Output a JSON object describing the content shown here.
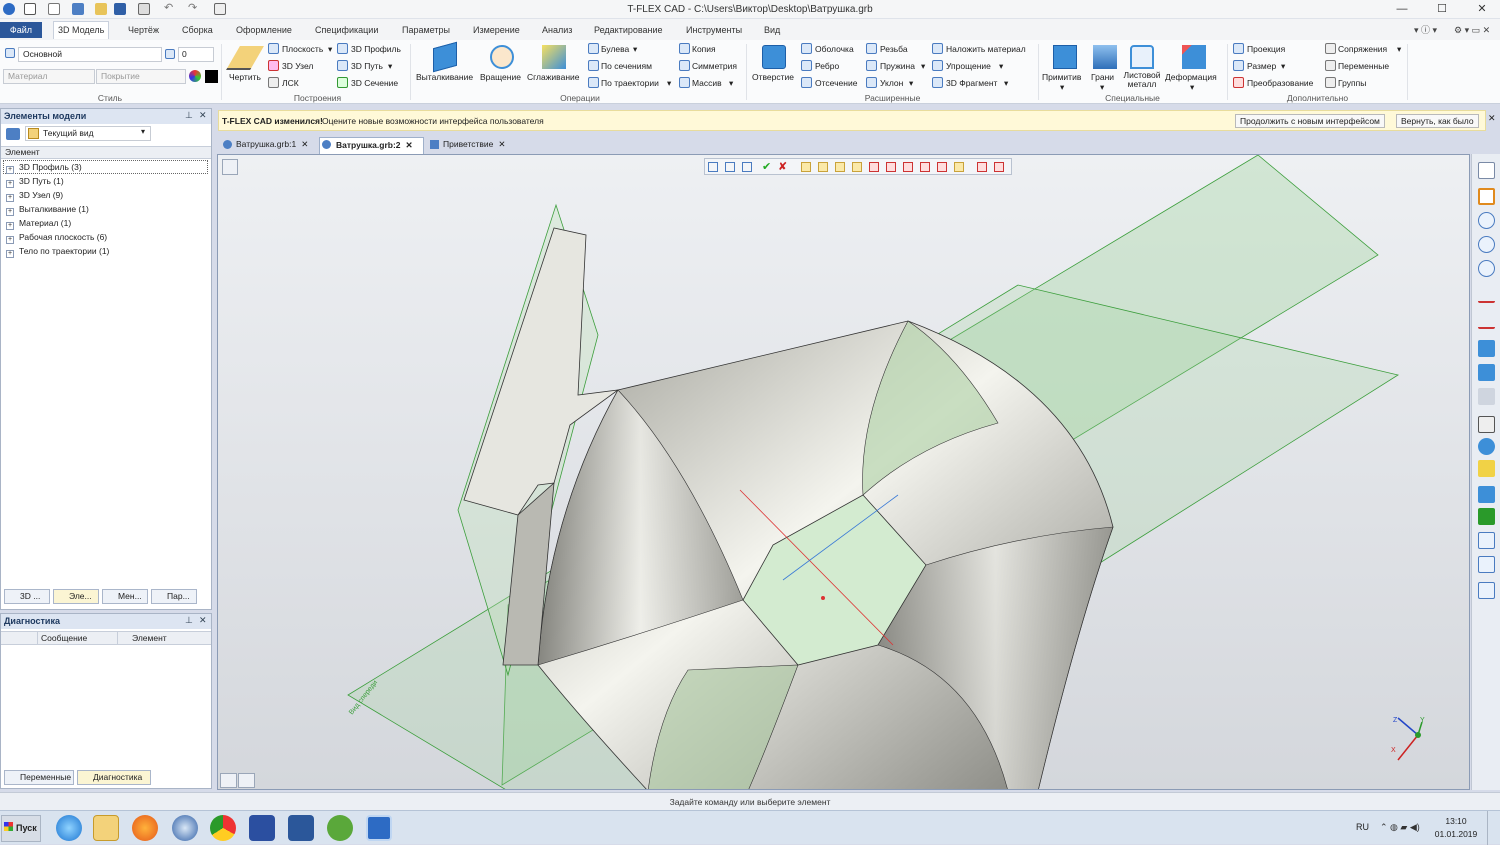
{
  "window": {
    "title": "T-FLEX CAD - C:\\Users\\Виктор\\Desktop\\Ватрушка.grb"
  },
  "menu_tabs": [
    "Файл",
    "3D Модель",
    "Чертёж",
    "Сборка",
    "Оформление",
    "Спецификации",
    "Параметры",
    "Измерение",
    "Анализ",
    "Редактирование",
    "Инструменты",
    "Вид"
  ],
  "style_group": {
    "layer": "Основной",
    "number": "0",
    "material": "Материал",
    "coating": "Покрытие",
    "label": "Стиль"
  },
  "groups": {
    "build": "Построения",
    "ops": "Операции",
    "ext": "Расширенные",
    "special": "Специальные",
    "extra": "Дополнительно"
  },
  "ribbon": {
    "draw": "Чертить",
    "plane": "Плоскость",
    "node3d": "3D Узел",
    "lsk": "ЛСК",
    "profile3d": "3D Профиль",
    "path3d": "3D Путь",
    "section3d": "3D Сечение",
    "extrude": "Выталкивание",
    "rotate": "Вращение",
    "smooth": "Сглаживание",
    "boolean": "Булева",
    "by_sections": "По сечениям",
    "by_path": "По траектории",
    "copy": "Копия",
    "symmetry": "Симметрия",
    "array": "Массив",
    "hole": "Отверстие",
    "shell": "Оболочка",
    "rib": "Ребро",
    "cut": "Отсечение",
    "thread": "Резьба",
    "spring": "Пружина",
    "slope": "Уклон",
    "apply_material": "Наложить материал",
    "simplify": "Упрощение",
    "fragment3d": "3D Фрагмент",
    "primitive": "Примитив",
    "faces": "Грани",
    "sheet_metal": "Листовой металл",
    "deformation": "Деформация",
    "projection": "Проекция",
    "size": "Размер",
    "transform": "Преобразование",
    "mates": "Сопряжения",
    "variables": "Переменные",
    "groups_btn": "Группы"
  },
  "model_panel": {
    "title": "Элементы модели",
    "view": "Текущий вид",
    "column": "Элемент",
    "items": [
      "3D Профиль (3)",
      "3D Путь (1)",
      "3D Узел (9)",
      "Выталкивание (1)",
      "Материал (1)",
      "Рабочая плоскость (6)",
      "Тело по траектории (1)"
    ],
    "tabs": [
      "3D ...",
      "Эле...",
      "Мен...",
      "Пар..."
    ]
  },
  "diag_panel": {
    "title": "Диагностика",
    "col_message": "Сообщение",
    "col_element": "Элемент",
    "tabs": [
      "Переменные",
      "Диагностика"
    ]
  },
  "notification": {
    "bold": "T-FLEX CAD изменился!",
    "text": "Оцените новые возможности интерфейса пользователя",
    "btn_new": "Продолжить с новым интерфейсом",
    "btn_old": "Вернуть, как было"
  },
  "doc_tabs": [
    "Ватрушка.grb:1",
    "Ватрушка.grb:2",
    "Приветствие"
  ],
  "viewport": {
    "plane_label": "Вид спереди",
    "axes": {
      "x": "X",
      "y": "Y",
      "z": "Z"
    }
  },
  "status": "Задайте команду или выберите элемент",
  "taskbar": {
    "start": "Пуск",
    "lang": "RU",
    "time": "13:10",
    "date": "01.01.2019"
  }
}
